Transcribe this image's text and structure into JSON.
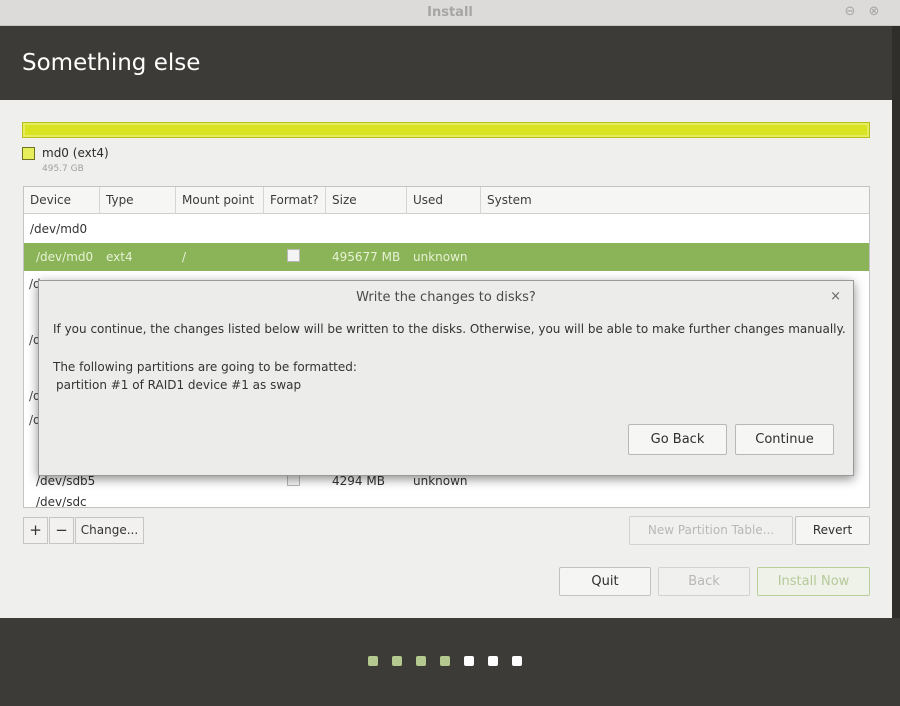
{
  "window": {
    "title": "Install",
    "minimize_glyph": "⊖",
    "close_glyph": "⊗"
  },
  "header": {
    "title": "Something else"
  },
  "disk": {
    "legend_name": "md0 (ext4)",
    "legend_size": "495.7 GB",
    "bar_color": "#d9e321"
  },
  "table": {
    "columns": [
      "Device",
      "Type",
      "Mount point",
      "Format?",
      "Size",
      "Used",
      "System"
    ],
    "rows": [
      {
        "device": "/dev/md0"
      },
      {
        "device": "/dev/md0",
        "type": "ext4",
        "mount": "/",
        "format": "",
        "size": "495677 MB",
        "used": "unknown",
        "system": ""
      }
    ],
    "hidden_fragments": [
      "/d",
      "/d",
      "/d",
      "/d"
    ],
    "partial_row": {
      "device": "/dev/sdb5",
      "size": "4294 MB",
      "used": "unknown"
    },
    "last_row": {
      "device": "/dev/sdc"
    },
    "selected_color": "#8bb358"
  },
  "toolbar": {
    "add_label": "+",
    "remove_label": "−",
    "change_label": "Change...",
    "new_table_label": "New Partition Table...",
    "revert_label": "Revert"
  },
  "actions": {
    "quit_label": "Quit",
    "back_label": "Back",
    "install_label": "Install Now"
  },
  "dialog": {
    "title": "Write the changes to disks?",
    "close_glyph": "×",
    "message": "If you continue, the changes listed below will be written to the disks. Otherwise, you will be able to make further changes manually.",
    "format_heading": "The following partitions are going to be formatted:",
    "format_item": "partition #1 of RAID1 device #1 as swap",
    "go_back_label": "Go Back",
    "continue_label": "Continue"
  },
  "progress": {
    "total_steps": 7,
    "completed_steps": 4,
    "done_color": "#b3c98e",
    "todo_color": "#ffffff"
  }
}
